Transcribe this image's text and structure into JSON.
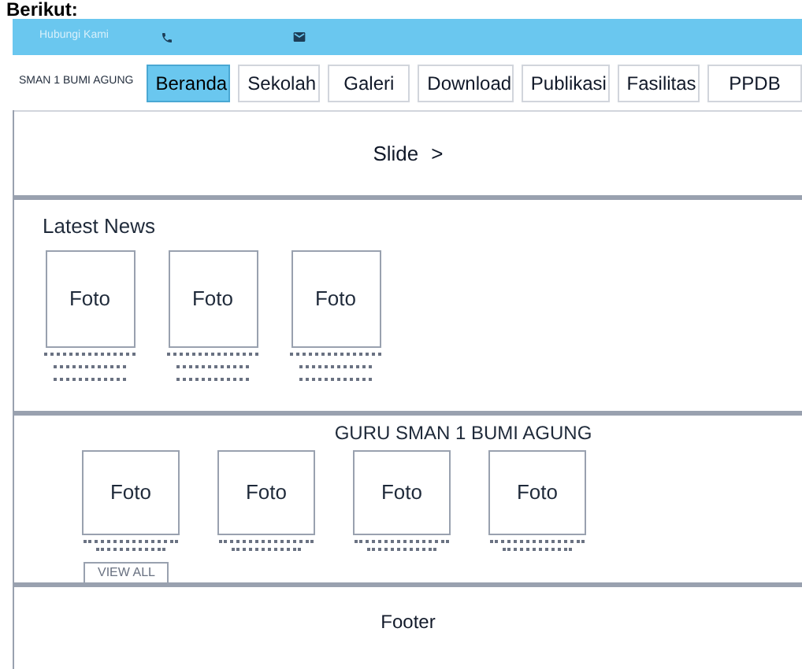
{
  "caption": "Berikut:",
  "topbar": {
    "contact_label": "Hubungi Kami"
  },
  "navbar": {
    "brand": "SMAN 1 BUMI AGUNG",
    "items": [
      {
        "label": "Beranda",
        "selected": true
      },
      {
        "label": "Sekolah",
        "selected": false
      },
      {
        "label": "Galeri",
        "selected": false
      },
      {
        "label": "Download",
        "selected": false
      },
      {
        "label": "Publikasi",
        "selected": false
      },
      {
        "label": "Fasilitas",
        "selected": false
      },
      {
        "label": "PPDB",
        "selected": false
      }
    ]
  },
  "slider": {
    "label": "Slide",
    "arrow": ">"
  },
  "latest_news": {
    "title": "Latest News",
    "items": [
      {
        "photo": "Foto"
      },
      {
        "photo": "Foto"
      },
      {
        "photo": "Foto"
      }
    ]
  },
  "teachers": {
    "title": "GURU SMAN 1 BUMI AGUNG",
    "items": [
      {
        "photo": "Foto"
      },
      {
        "photo": "Foto"
      },
      {
        "photo": "Foto"
      },
      {
        "photo": "Foto"
      }
    ],
    "button": "VIEW ALL"
  },
  "footer": {
    "label": "Footer"
  }
}
